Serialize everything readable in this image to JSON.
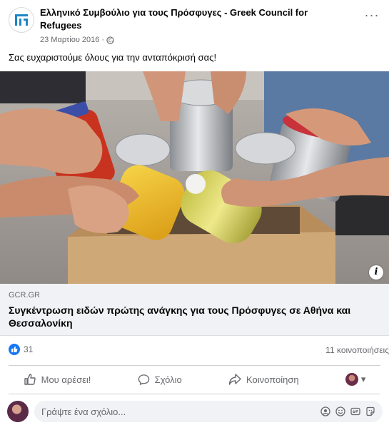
{
  "post": {
    "page_name": "Ελληνικό Συμβούλιο για τους Πρόσφυγες - Greek Council for Refugees",
    "date": "23 Μαρτίου 2016",
    "separator": "·",
    "audience_icon": "globe-icon",
    "text": "Σας ευχαριστούμε όλους για την ανταπόκρισή σας!",
    "more_icon": "more-options-icon",
    "more_symbol": "···"
  },
  "link": {
    "domain": "GCR.GR",
    "title": "Συγκέντρωση ειδών πρώτης ανάγκης για τους Πρόσφυγες σε Αθήνα και Θεσσαλονίκη",
    "info_symbol": "i"
  },
  "stats": {
    "likes": "31",
    "shares": "11 κοινοποιήσεις"
  },
  "actions": {
    "like": "Μου αρέσει!",
    "comment": "Σχόλιο",
    "share": "Κοινοποίηση",
    "audience_caret": "▾"
  },
  "comment_box": {
    "placeholder": "Γράψτε ένα σχόλιο..."
  },
  "colors": {
    "brand_blue": "#1877f2",
    "text_secondary": "#65676b",
    "surface_gray": "#f0f2f5"
  }
}
